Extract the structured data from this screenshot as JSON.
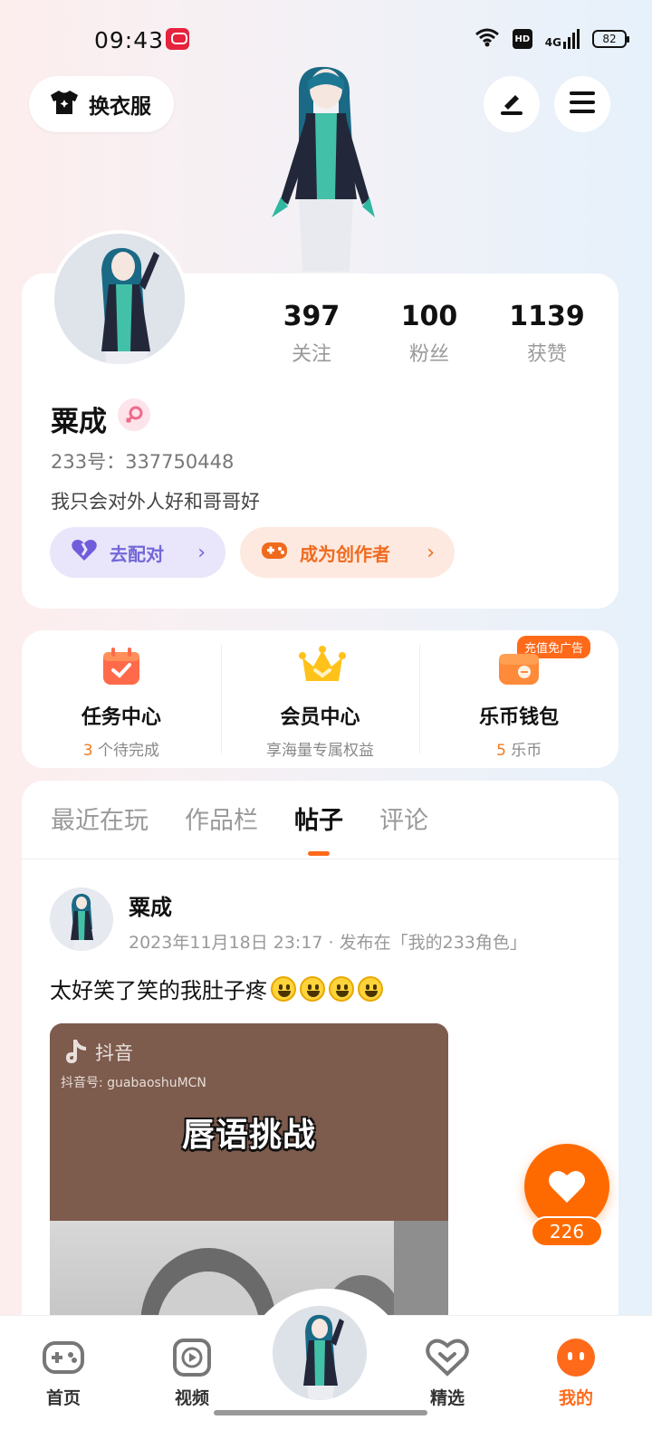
{
  "status_bar": {
    "time": "09:43",
    "network": "4G",
    "hd_label": "HD",
    "battery": "82",
    "icons": [
      "wifi-icon",
      "hd-icon",
      "signal-icon",
      "battery-icon"
    ]
  },
  "header": {
    "outfit_button": "换衣服",
    "edit_icon": "edit-icon",
    "menu_icon": "menu-icon"
  },
  "profile": {
    "stats": [
      {
        "num": "397",
        "label": "关注"
      },
      {
        "num": "100",
        "label": "粉丝"
      },
      {
        "num": "1139",
        "label": "获赞"
      }
    ],
    "name": "粟成",
    "gender_icon": "female-icon",
    "id_text": "233号：337750448",
    "bio": "我只会对外人好和哥哥好",
    "match_button": "去配对",
    "creator_button": "成为创作者"
  },
  "services": [
    {
      "title": "任务中心",
      "sub_num": "3",
      "sub_text": " 个待完成",
      "icon": "task-calendar-icon"
    },
    {
      "title": "会员中心",
      "sub_num": "",
      "sub_text": "享海量专属权益",
      "icon": "crown-icon"
    },
    {
      "title": "乐币钱包",
      "sub_num": "5",
      "sub_text": " 乐币",
      "icon": "wallet-icon",
      "tag": "充值免广告"
    }
  ],
  "feed": {
    "tabs": [
      "最近在玩",
      "作品栏",
      "帖子",
      "评论"
    ],
    "active_tab": "帖子",
    "post": {
      "author": "粟成",
      "meta": "2023年11月18日 23:17 · 发布在「我的233角色」",
      "text": "太好笑了笑的我肚子疼",
      "emoji_count": 4,
      "video": {
        "platform": "抖音",
        "account": "抖音号: guabaoshuMCN",
        "title": "唇语挑战"
      }
    },
    "like_count": "226"
  },
  "bottom_nav": [
    {
      "label": "首页",
      "icon": "gamepad-icon"
    },
    {
      "label": "视频",
      "icon": "video-play-icon"
    },
    {
      "label": "精选",
      "icon": "heart-badge-icon"
    },
    {
      "label": "我的",
      "icon": "profile-face-icon",
      "active": true
    }
  ],
  "colors": {
    "accent": "#ff6a1a",
    "match_purple": "#7367d8",
    "background_left": "#fdeeee",
    "background_right": "#e6f1fb"
  }
}
